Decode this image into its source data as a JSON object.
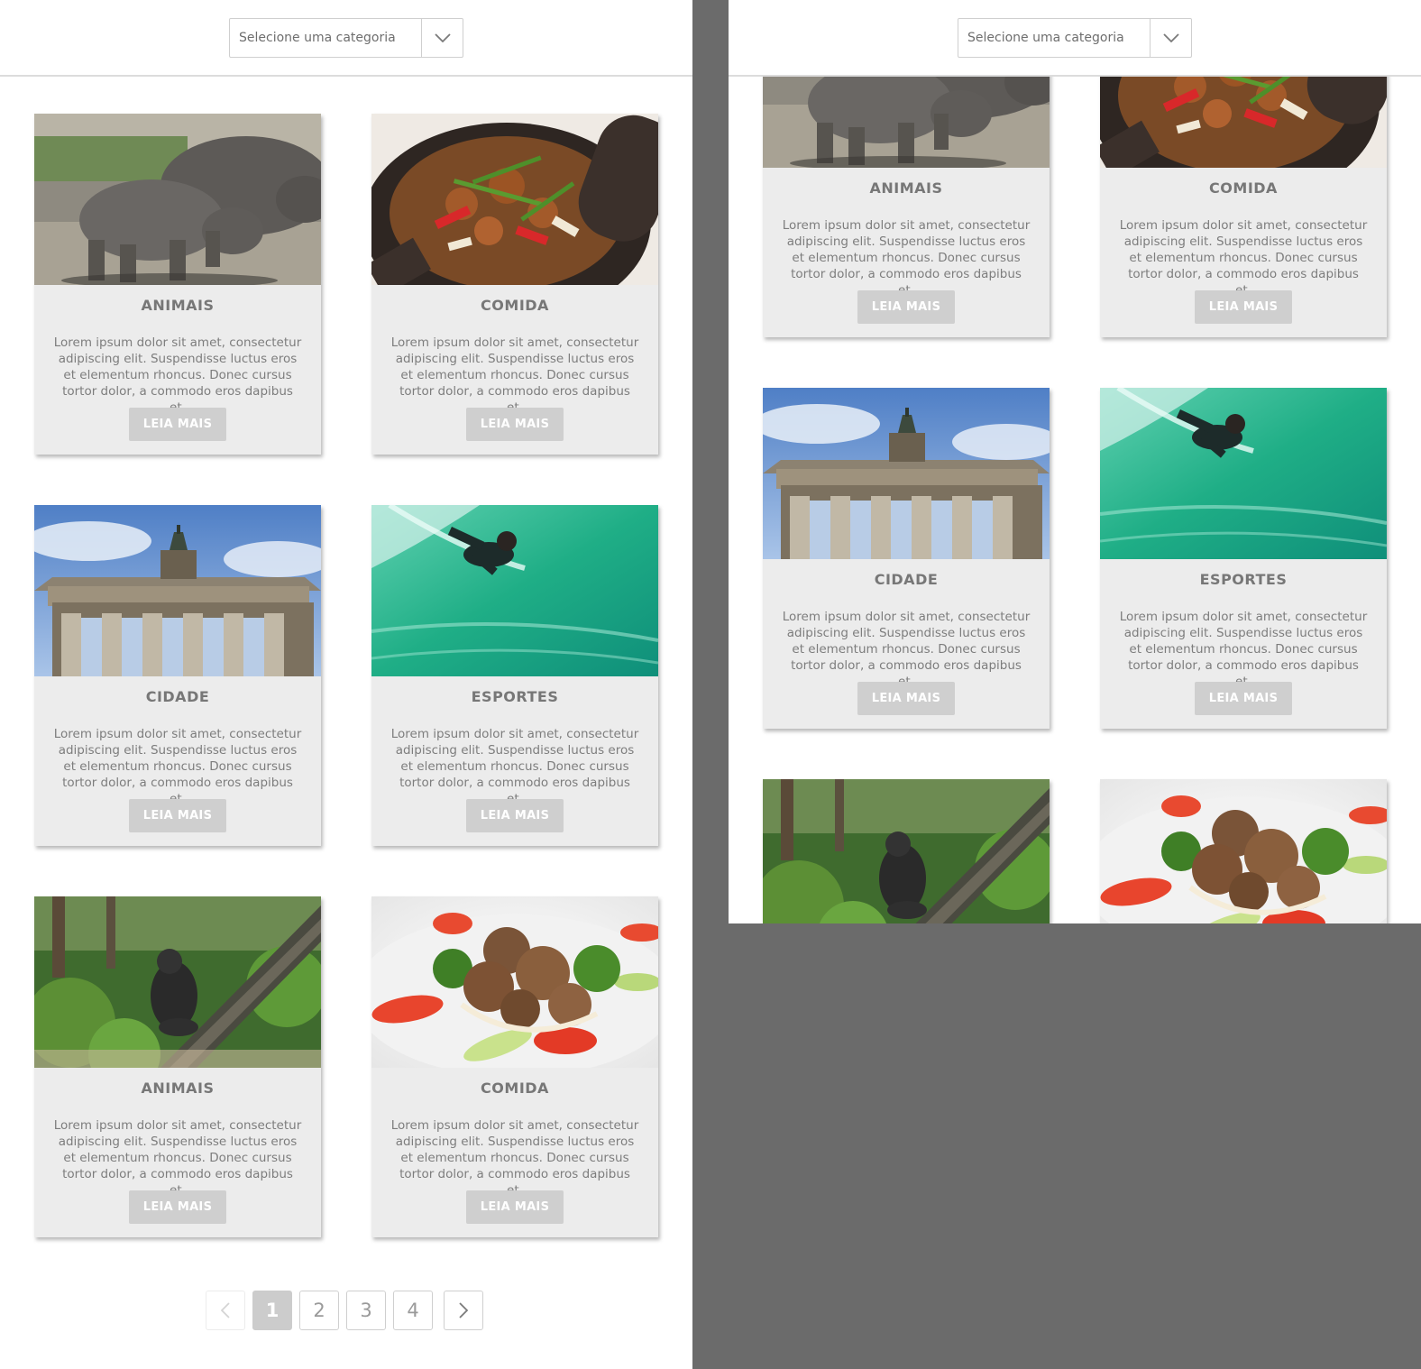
{
  "category_select": {
    "placeholder": "Selecione uma categoria"
  },
  "cards": [
    {
      "category": "ANIMAIS",
      "image": "rhinoceros-photo",
      "text": "Lorem ipsum dolor sit amet, consectetur adipiscing elit. Suspendisse luctus eros et elementum rhoncus. Donec cursus tortor dolor, a commodo eros dapibus et.",
      "button": "LEIA MAIS"
    },
    {
      "category": "COMIDA",
      "image": "stew-pot-photo",
      "text": "Lorem ipsum dolor sit amet, consectetur adipiscing elit. Suspendisse luctus eros et elementum rhoncus. Donec cursus tortor dolor, a commodo eros dapibus et.",
      "button": "LEIA MAIS"
    },
    {
      "category": "CIDADE",
      "image": "brandenburg-gate-photo",
      "text": "Lorem ipsum dolor sit amet, consectetur adipiscing elit. Suspendisse luctus eros et elementum rhoncus. Donec cursus tortor dolor, a commodo eros dapibus et.",
      "button": "LEIA MAIS"
    },
    {
      "category": "ESPORTES",
      "image": "surfer-photo",
      "text": "Lorem ipsum dolor sit amet, consectetur adipiscing elit. Suspendisse luctus eros et elementum rhoncus. Donec cursus tortor dolor, a commodo eros dapibus et.",
      "button": "LEIA MAIS"
    },
    {
      "category": "ANIMAIS",
      "image": "gorilla-photo",
      "text": "Lorem ipsum dolor sit amet, consectetur adipiscing elit. Suspendisse luctus eros et elementum rhoncus. Donec cursus tortor dolor, a commodo eros dapibus et.",
      "button": "LEIA MAIS"
    },
    {
      "category": "COMIDA",
      "image": "beef-salad-photo",
      "text": "Lorem ipsum dolor sit amet, consectetur adipiscing elit. Suspendisse luctus eros et elementum rhoncus. Donec cursus tortor dolor, a commodo eros dapibus et.",
      "button": "LEIA MAIS"
    }
  ],
  "pagination": {
    "prev_icon": "chevron-left-icon",
    "pages": [
      "1",
      "2",
      "3",
      "4"
    ],
    "current": "1",
    "next_icon": "chevron-right-icon"
  },
  "colors": {
    "background": "#6b6b6b",
    "card": "#ececec",
    "button": "#cfcfcf",
    "active_page": "#cccccc"
  }
}
